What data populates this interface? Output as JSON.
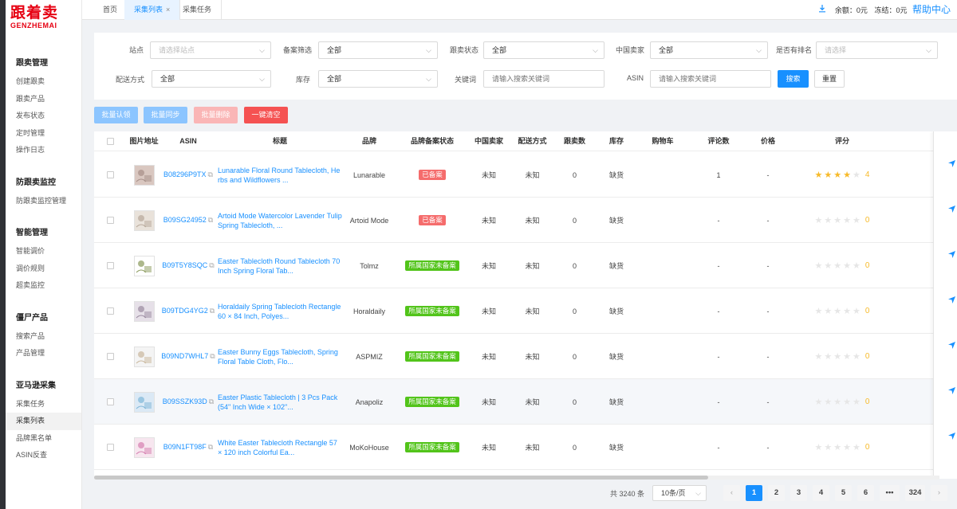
{
  "logo": {
    "cn": "跟着卖",
    "en": "GENZHEMAI"
  },
  "sidebar": [
    {
      "title": "跟卖管理",
      "items": [
        "创建跟卖",
        "跟卖产品",
        "发布状态",
        "定时管理",
        "操作日志"
      ]
    },
    {
      "title": "防跟卖监控",
      "items": [
        "防跟卖监控管理"
      ]
    },
    {
      "title": "智能管理",
      "items": [
        "智能调价",
        "调价规则",
        "超卖监控"
      ]
    },
    {
      "title": "僵尸产品",
      "items": [
        "搜索产品",
        "产品管理"
      ]
    },
    {
      "title": "亚马逊采集",
      "items": [
        "采集任务",
        "采集列表",
        "品牌黑名单",
        "ASIN反查"
      ]
    }
  ],
  "sidebar_active": "采集列表",
  "tabs": [
    {
      "label": "首页"
    },
    {
      "label": "采集列表",
      "close": "×"
    },
    {
      "label": "采集任务"
    }
  ],
  "topbar": {
    "balance": "余额：0元",
    "frozen": "冻结：0元",
    "help": "帮助中心"
  },
  "filters": {
    "site": {
      "label": "站点",
      "placeholder": "请选择站点"
    },
    "filing": {
      "label": "备案筛选",
      "value": "全部"
    },
    "follow_status": {
      "label": "跟卖状态",
      "value": "全部"
    },
    "china_seller": {
      "label": "中国卖家",
      "value": "全部"
    },
    "ranked": {
      "label": "是否有排名",
      "placeholder": "请选择"
    },
    "shipping": {
      "label": "配送方式",
      "value": "全部"
    },
    "stock": {
      "label": "库存",
      "value": "全部"
    },
    "keyword": {
      "label": "关键词",
      "placeholder": "请输入搜索关键词"
    },
    "asin": {
      "label": "ASIN",
      "placeholder": "请输入搜索关键词"
    },
    "search_btn": "搜索",
    "reset_btn": "重置"
  },
  "actions": {
    "claim": "批量认领",
    "sync": "批量同步",
    "delete": "批量删除",
    "clear": "一键清空"
  },
  "columns": [
    "图片地址",
    "ASIN",
    "标题",
    "品牌",
    "品牌备案状态",
    "中国卖家",
    "配送方式",
    "跟卖数",
    "库存",
    "购物车",
    "评论数",
    "价格",
    "评分"
  ],
  "rows": [
    {
      "asin": "B08296P9TX",
      "title": "Lunarable Floral Round Tablecloth, Herbs and Wildflowers ...",
      "brand": "Lunarable",
      "filing": "已备案",
      "filing_type": "red",
      "china": "未知",
      "ship": "未知",
      "follow": "0",
      "stock": "缺货",
      "cart": "",
      "reviews": "1",
      "price": "-",
      "rating": 4,
      "score": "4"
    },
    {
      "asin": "B09SG24952",
      "title": "Artoid Mode Watercolor Lavender Tulip Spring Tablecloth, ...",
      "brand": "Artoid Mode",
      "filing": "已备案",
      "filing_type": "red",
      "china": "未知",
      "ship": "未知",
      "follow": "0",
      "stock": "缺货",
      "cart": "",
      "reviews": "-",
      "price": "-",
      "rating": 0,
      "score": "0"
    },
    {
      "asin": "B09T5Y8SQC",
      "title": "Easter Tablecloth Round Tablecloth 70 Inch Spring Floral Tab...",
      "brand": "Tolmz",
      "filing": "所属国家未备案",
      "filing_type": "green",
      "china": "未知",
      "ship": "未知",
      "follow": "0",
      "stock": "缺货",
      "cart": "",
      "reviews": "-",
      "price": "-",
      "rating": 0,
      "score": "0"
    },
    {
      "asin": "B09TDG4YG2",
      "title": "Horaldaily Spring Tablecloth Rectangle 60 × 84 Inch, Polyes...",
      "brand": "Horaldaily",
      "filing": "所属国家未备案",
      "filing_type": "green",
      "china": "未知",
      "ship": "未知",
      "follow": "0",
      "stock": "缺货",
      "cart": "",
      "reviews": "-",
      "price": "-",
      "rating": 0,
      "score": "0"
    },
    {
      "asin": "B09ND7WHL7",
      "title": "Easter Bunny Eggs Tablecloth, Spring Floral Table Cloth, Flo...",
      "brand": "ASPMIZ",
      "filing": "所属国家未备案",
      "filing_type": "green",
      "china": "未知",
      "ship": "未知",
      "follow": "0",
      "stock": "缺货",
      "cart": "",
      "reviews": "-",
      "price": "-",
      "rating": 0,
      "score": "0"
    },
    {
      "asin": "B09SSZK93D",
      "title": "Easter Plastic Tablecloth | 3 Pcs Pack (54\"   Inch Wide × 102\"...",
      "brand": "Anapoliz",
      "filing": "所属国家未备案",
      "filing_type": "green",
      "china": "未知",
      "ship": "未知",
      "follow": "0",
      "stock": "缺货",
      "cart": "",
      "reviews": "-",
      "price": "-",
      "rating": 0,
      "score": "0"
    },
    {
      "asin": "B09N1FT98F",
      "title": "White Easter Tablecloth Rectangle 57 × 120 inch Colorful Ea...",
      "brand": "MoKoHouse",
      "filing": "所属国家未备案",
      "filing_type": "green",
      "china": "未知",
      "ship": "未知",
      "follow": "0",
      "stock": "缺货",
      "cart": "",
      "reviews": "-",
      "price": "-",
      "rating": 0,
      "score": "0"
    }
  ],
  "pagination": {
    "total": "共 3240 条",
    "page_size": "10条/页",
    "pages": [
      "1",
      "2",
      "3",
      "4",
      "5",
      "6",
      "•••",
      "324"
    ],
    "current": "1",
    "prev": "‹",
    "next": "›"
  },
  "colors": {
    "accent": "#1890ff",
    "danger": "#f56c6c",
    "success": "#52c41a",
    "star": "#f7ba2a",
    "brand": "#e60012"
  }
}
